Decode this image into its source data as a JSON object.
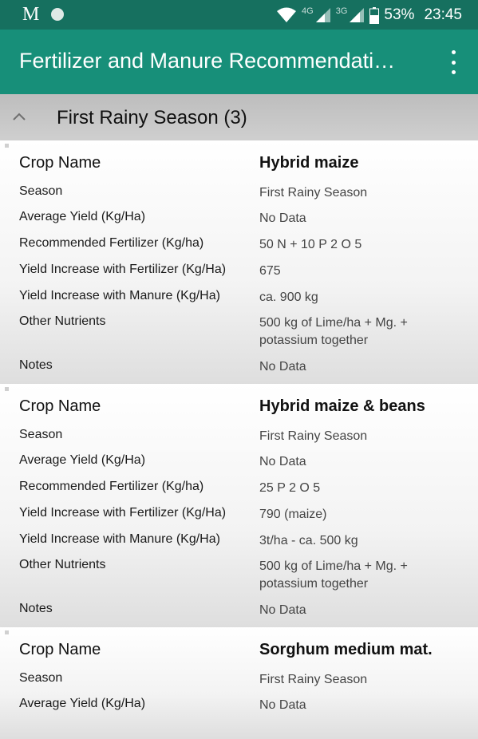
{
  "status_bar": {
    "left_glyph": "M",
    "network_4g": "4G",
    "network_3g": "3G",
    "battery": "53%",
    "time": "23:45",
    "icons": [
      "gmail-icon",
      "notification-dot-icon",
      "wifi-icon",
      "signal-icon",
      "signal-icon",
      "battery-icon"
    ]
  },
  "app_bar": {
    "title": "Fertilizer and Manure Recommendati…",
    "menu_icon": "more-vert-icon"
  },
  "group": {
    "title": "First Rainy Season (3)",
    "chevron_icon": "chevron-up-icon"
  },
  "labels": {
    "crop_name": "Crop Name",
    "season": "Season",
    "average_yield": "Average Yield (Kg/Ha)",
    "recommended_fertilizer": "Recommended Fertilizer (Kg/ha)",
    "yield_fertilizer": "Yield Increase with Fertilizer (Kg/Ha)",
    "yield_manure": "Yield Increase with Manure (Kg/Ha)",
    "other_nutrients": "Other Nutrients",
    "notes": "Notes"
  },
  "crops": [
    {
      "crop_name": "Hybrid maize",
      "season": "First Rainy Season",
      "average_yield": "No Data",
      "recommended_fertilizer": "50 N + 10 P 2 O 5",
      "yield_fertilizer": "675",
      "yield_manure": "ca. 900 kg",
      "other_nutrients": "500 kg of Lime/ha + Mg. + potassium together",
      "notes": "No Data"
    },
    {
      "crop_name": "Hybrid maize & beans",
      "season": "First Rainy Season",
      "average_yield": "No Data",
      "recommended_fertilizer": "25 P 2 O 5",
      "yield_fertilizer": "790 (maize)",
      "yield_manure": "3t/ha - ca. 500 kg",
      "other_nutrients": "500 kg of Lime/ha + Mg. + potassium together",
      "notes": "No Data"
    },
    {
      "crop_name": "Sorghum medium mat.",
      "season": "First Rainy Season",
      "average_yield": "No Data"
    }
  ]
}
